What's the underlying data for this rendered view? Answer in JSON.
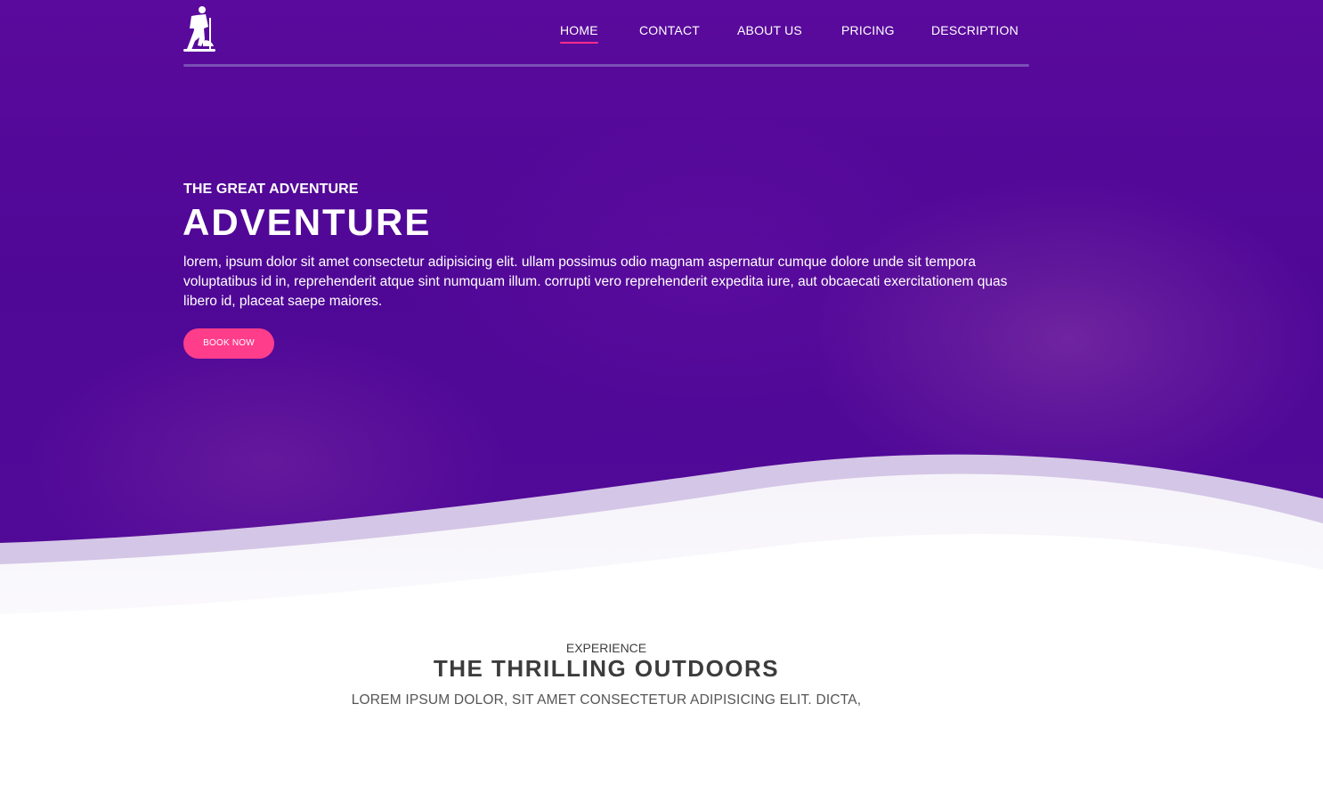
{
  "nav": {
    "items": [
      {
        "label": "HOME",
        "active": true
      },
      {
        "label": "CONTACT",
        "active": false
      },
      {
        "label": "ABOUT US",
        "active": false
      },
      {
        "label": "PRICING",
        "active": false
      },
      {
        "label": "DESCRIPTION",
        "active": false
      }
    ]
  },
  "hero": {
    "eyebrow": "THE GREAT ADVENTURE",
    "title": "ADVENTURE",
    "body": "lorem, ipsum dolor sit amet consectetur adipisicing elit. ullam possimus odio magnam aspernatur cumque dolore unde sit tempora voluptatibus id in, reprehenderit atque sint numquam illum. corrupti vero reprehenderit expedita iure, aut obcaecati exercitationem quas libero id, placeat saepe maiores.",
    "cta_label": "BOOK NOW"
  },
  "section": {
    "eyebrow": "EXPERIENCE",
    "title": "THE THRILLING OUTDOORS",
    "subtitle": "LOREM IPSUM DOLOR, SIT AMET CONSECTETUR ADIPISICING ELIT. DICTA,"
  },
  "colors": {
    "hero_purple": "#520a99",
    "accent_pink": "#ff3d8b",
    "nav_underline": "#ff2d8a",
    "text_dark": "#3c3c3c"
  }
}
